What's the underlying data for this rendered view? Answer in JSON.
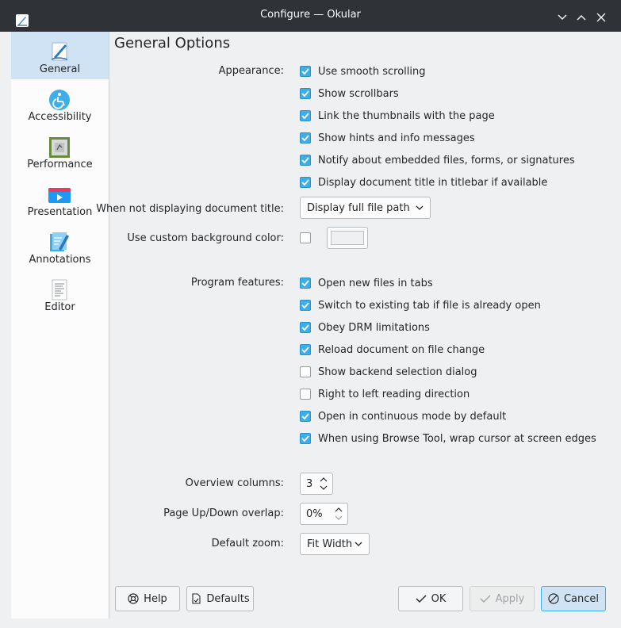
{
  "window": {
    "title": "Configure — Okular"
  },
  "sidebar": {
    "items": [
      {
        "label": "General",
        "icon": "general-icon",
        "active": true
      },
      {
        "label": "Accessibility",
        "icon": "accessibility-icon",
        "active": false
      },
      {
        "label": "Performance",
        "icon": "performance-icon",
        "active": false
      },
      {
        "label": "Presentation",
        "icon": "presentation-icon",
        "active": false
      },
      {
        "label": "Annotations",
        "icon": "annotations-icon",
        "active": false
      },
      {
        "label": "Editor",
        "icon": "editor-icon",
        "active": false
      }
    ]
  },
  "page": {
    "heading": "General Options",
    "appearance": {
      "label": "Appearance:",
      "options": [
        {
          "label": "Use smooth scrolling",
          "checked": true
        },
        {
          "label": "Show scrollbars",
          "checked": true
        },
        {
          "label": "Link the thumbnails with the page",
          "checked": true
        },
        {
          "label": "Show hints and info messages",
          "checked": true
        },
        {
          "label": "Notify about embedded files, forms, or signatures",
          "checked": true
        },
        {
          "label": "Display document title in titlebar if available",
          "checked": true
        }
      ]
    },
    "doc_title": {
      "label": "When not displaying document title:",
      "value": "Display full file path"
    },
    "custom_bg": {
      "label": "Use custom background color:",
      "checked": false
    },
    "program_features": {
      "label": "Program features:",
      "options": [
        {
          "label": "Open new files in tabs",
          "checked": true
        },
        {
          "label": "Switch to existing tab if file is already open",
          "checked": true
        },
        {
          "label": "Obey DRM limitations",
          "checked": true
        },
        {
          "label": "Reload document on file change",
          "checked": true
        },
        {
          "label": "Show backend selection dialog",
          "checked": false
        },
        {
          "label": "Right to left reading direction",
          "checked": false
        },
        {
          "label": "Open in continuous mode by default",
          "checked": true
        },
        {
          "label": "When using Browse Tool, wrap cursor at screen edges",
          "checked": true
        }
      ]
    },
    "overview_columns": {
      "label": "Overview columns:",
      "value": "3"
    },
    "page_overlap": {
      "label": "Page Up/Down overlap:",
      "value": "0%"
    },
    "default_zoom": {
      "label": "Default zoom:",
      "value": "Fit Width"
    }
  },
  "buttons": {
    "help": "Help",
    "defaults": "Defaults",
    "ok": "OK",
    "apply": "Apply",
    "cancel": "Cancel"
  },
  "colors": {
    "accent": "#3daee9",
    "titlebar": "#2f3338",
    "selection": "#cfe3f5"
  }
}
